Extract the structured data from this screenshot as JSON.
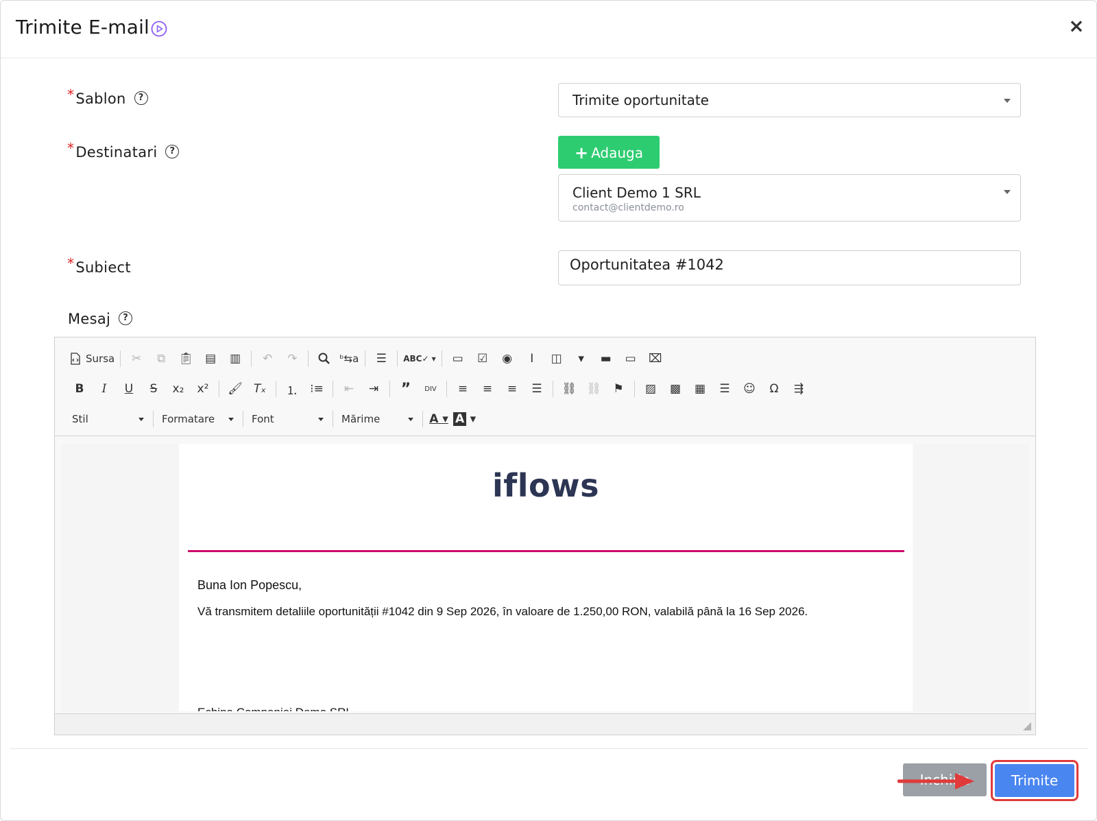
{
  "modal": {
    "title": "Trimite E-mail",
    "close_glyph": "×"
  },
  "form": {
    "template": {
      "label": "Sablon",
      "required_mark": "*",
      "help_glyph": "?",
      "value": "Trimite oportunitate"
    },
    "recipients": {
      "label": "Destinatari",
      "required_mark": "*",
      "help_glyph": "?",
      "add_label": "Adauga",
      "add_glyph": "+",
      "selected_name": "Client Demo 1 SRL",
      "selected_email": "contact@clientdemo.ro"
    },
    "subject": {
      "label": "Subiect",
      "required_mark": "*",
      "value": "Oportunitatea #1042"
    },
    "message": {
      "label": "Mesaj",
      "help_glyph": "?"
    }
  },
  "editor": {
    "source_label": "Sursa",
    "combos": {
      "style": "Stil",
      "format": "Formatare",
      "font": "Font",
      "size": "Mărime"
    },
    "icons_row1": [
      "source-icon",
      "cut-icon",
      "copy-icon",
      "paste-icon",
      "paste-text-icon",
      "paste-word-icon",
      "undo-icon",
      "redo-icon",
      "find-icon",
      "replace-icon",
      "select-all-icon",
      "spellcheck-icon",
      "form-icon",
      "checkbox-icon",
      "radio-icon",
      "textfield-icon",
      "textarea-icon",
      "select-icon",
      "button-icon",
      "image-button-icon",
      "hidden-field-icon"
    ],
    "icons_row2": [
      "bold-icon",
      "italic-icon",
      "underline-icon",
      "strike-icon",
      "subscript-icon",
      "superscript-icon",
      "copy-format-icon",
      "remove-format-icon",
      "numbered-list-icon",
      "bulleted-list-icon",
      "outdent-icon",
      "indent-icon",
      "blockquote-icon",
      "div-icon",
      "align-left-icon",
      "align-center-icon",
      "align-right-icon",
      "justify-icon",
      "link-icon",
      "unlink-icon",
      "anchor-icon",
      "image-icon",
      "flash-icon",
      "table-icon",
      "horizontal-line-icon",
      "smiley-icon",
      "special-char-icon",
      "page-break-icon"
    ],
    "content": {
      "brand": "iflows",
      "brand_line_color": "#cc0a6a",
      "greeting": "Buna Ion Popescu,",
      "body": "Vă transmitem detaliile oportunității #1042 din 9 Sep 2026, în valoare de 1.250,00 RON, valabilă până la 16 Sep 2026.",
      "signature": "Echipa Companiei Demo SRL"
    }
  },
  "footer": {
    "close_label": "Inchide",
    "send_label": "Trimite"
  },
  "colors": {
    "add_button": "#2ecc71",
    "send_button": "#4a86f0",
    "close_button": "#9aa0a6",
    "highlight": "#e03a3a",
    "accent_play": "#8b5cf6"
  }
}
